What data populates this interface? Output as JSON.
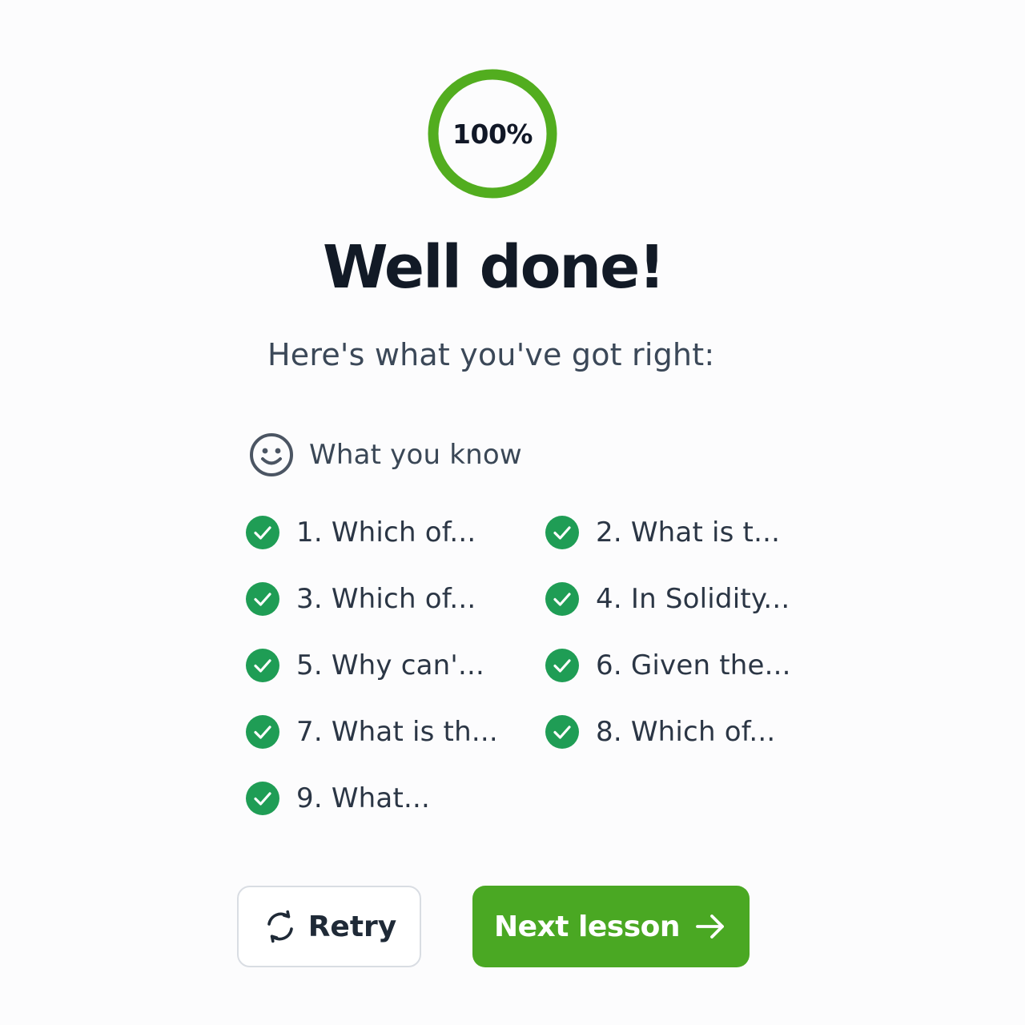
{
  "score": {
    "value": 100,
    "label": "100%"
  },
  "title": "Well done!",
  "subtitle": "Here's what you've got right:",
  "section": {
    "icon": "smile-icon",
    "label": "What you know"
  },
  "items": [
    {
      "label": "1. Which of...",
      "status": "correct"
    },
    {
      "label": "2. What is t...",
      "status": "correct"
    },
    {
      "label": "3. Which of...",
      "status": "correct"
    },
    {
      "label": "4. In Solidity...",
      "status": "correct"
    },
    {
      "label": "5. Why can'...",
      "status": "correct"
    },
    {
      "label": "6. Given the...",
      "status": "correct"
    },
    {
      "label": "7. What is th...",
      "status": "correct"
    },
    {
      "label": "8. Which of...",
      "status": "correct"
    },
    {
      "label": "9. What...",
      "status": "correct"
    }
  ],
  "buttons": {
    "retry": {
      "label": "Retry",
      "icon": "refresh-icon"
    },
    "next": {
      "label": "Next lesson",
      "icon": "arrow-right-icon"
    }
  },
  "colors": {
    "accent": "#4aa823",
    "check": "#1f9d55",
    "ring": "#52ad1f",
    "text_dark": "#121a26",
    "text_muted": "#3b4858"
  }
}
